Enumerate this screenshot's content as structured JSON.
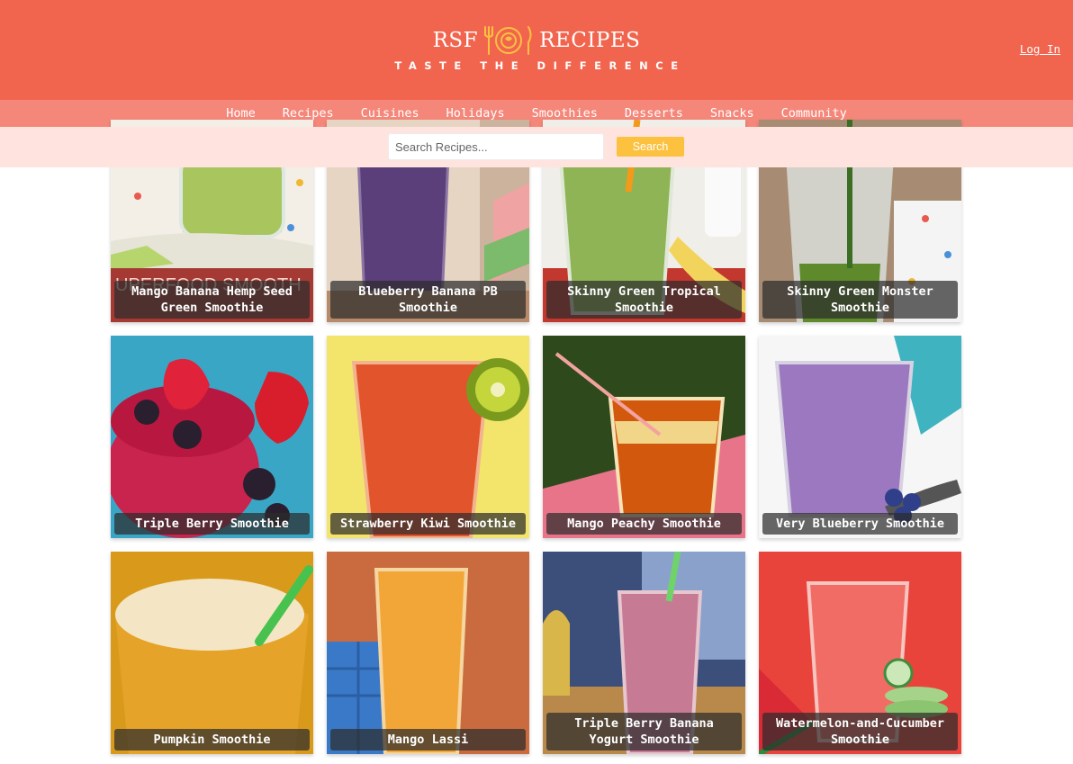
{
  "header": {
    "logo_left": "RSF",
    "logo_right": "RECIPES",
    "logo_icon": "fork-plate-knife-icon",
    "tagline": "TASTE THE DIFFERENCE",
    "login_label": "Log In",
    "colors": {
      "header_bg": "#f1654f",
      "nav_bg": "#f5877a",
      "search_bg": "#fee3df",
      "accent": "#fcc13f"
    }
  },
  "nav": {
    "items": [
      "Home",
      "Recipes",
      "Cuisines",
      "Holidays",
      "Smoothies",
      "Desserts",
      "Snacks",
      "Community"
    ]
  },
  "search": {
    "placeholder": "Search Recipes...",
    "button_label": "Search"
  },
  "recipes": [
    {
      "title": "Mango Banana Hemp Seed Green Smoothie",
      "image": "green-smoothie-jar-photo"
    },
    {
      "title": "Blueberry Banana PB Smoothie",
      "image": "purple-smoothie-glass-photo"
    },
    {
      "title": "Skinny Green Tropical Smoothie",
      "image": "green-smoothie-straw-photo"
    },
    {
      "title": "Skinny Green Monster Smoothie",
      "image": "green-smoothie-pour-photo"
    },
    {
      "title": "Triple Berry Smoothie",
      "image": "berry-smoothie-bowl-photo"
    },
    {
      "title": "Strawberry Kiwi Smoothie",
      "image": "red-smoothie-kiwi-photo"
    },
    {
      "title": "Mango Peachy Smoothie",
      "image": "orange-drink-straw-photo"
    },
    {
      "title": "Very Blueberry Smoothie",
      "image": "lavender-smoothie-photo"
    },
    {
      "title": "Pumpkin Smoothie",
      "image": "pumpkin-smoothie-photo"
    },
    {
      "title": "Mango Lassi",
      "image": "mango-lassi-photo"
    },
    {
      "title": "Triple Berry Banana Yogurt Smoothie",
      "image": "pink-smoothie-photo"
    },
    {
      "title": "Watermelon-and-Cucumber Smoothie",
      "image": "watermelon-smoothie-photo"
    }
  ]
}
